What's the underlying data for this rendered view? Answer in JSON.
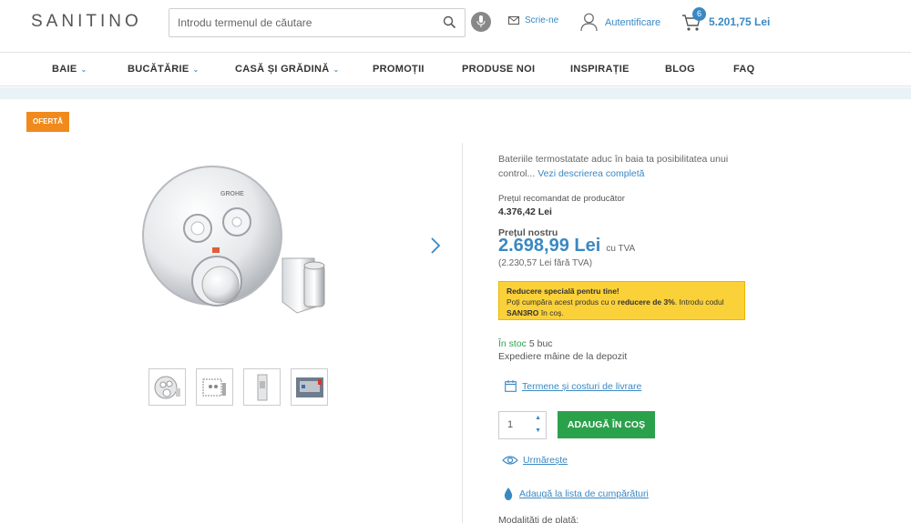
{
  "header": {
    "logo": "SANITINO",
    "search_placeholder": "Introdu termenul de căutare",
    "write_label": "Scrie-ne",
    "auth_label": "Autentificare",
    "cart_count": "6",
    "cart_total": "5.201,75 Lei"
  },
  "nav": {
    "items": [
      {
        "label": "BAIE",
        "has_dropdown": true
      },
      {
        "label": "BUCĂTĂRIE",
        "has_dropdown": true
      },
      {
        "label": "CASĂ ȘI GRĂDINĂ",
        "has_dropdown": true
      },
      {
        "label": "PROMOȚII",
        "has_dropdown": false
      },
      {
        "label": "PRODUSE NOI",
        "has_dropdown": false
      },
      {
        "label": "INSPIRAȚIE",
        "has_dropdown": false
      },
      {
        "label": "BLOG",
        "has_dropdown": false
      },
      {
        "label": "FAQ",
        "has_dropdown": false
      }
    ]
  },
  "product": {
    "badge": "OFERTĂ",
    "description": "Bateriile termostatate aduc în baia ta posibilitatea unui control...",
    "description_more": "Vezi descrierea completă",
    "recommended_label": "Prețul recomandat de producător",
    "recommended_price": "4.376,42 Lei",
    "our_price_label": "Prețul nostru",
    "our_price": "2.698,99 Lei",
    "our_price_tva": "cu TVA",
    "price_no_tva": "(2.230,57 Lei fără TVA)",
    "promo_title": "Reducere specială pentru tine!",
    "promo_text_1": "Poți cumpăra acest produs cu o",
    "promo_bold": "reducere de 3%",
    "promo_text_2": ". Introdu codul",
    "promo_code": "SAN3RO",
    "promo_text_3": "în coș.",
    "stock_green": "În stoc",
    "stock_qty": "5 buc",
    "shipping": "Expediere mâine de la depozit",
    "delivery_link": "Termene și costuri de livrare",
    "quantity": "1",
    "add_to_cart": "ADAUGĂ ÎN COȘ",
    "follow": "Urmărește",
    "add_list": "Adaugă la lista de cumpărături",
    "payment": "Modalități de plată:"
  },
  "colors": {
    "accent": "#3a88c2",
    "badge": "#f08a1d",
    "cta": "#2ca14c",
    "promo_bg": "#fbd13a"
  }
}
